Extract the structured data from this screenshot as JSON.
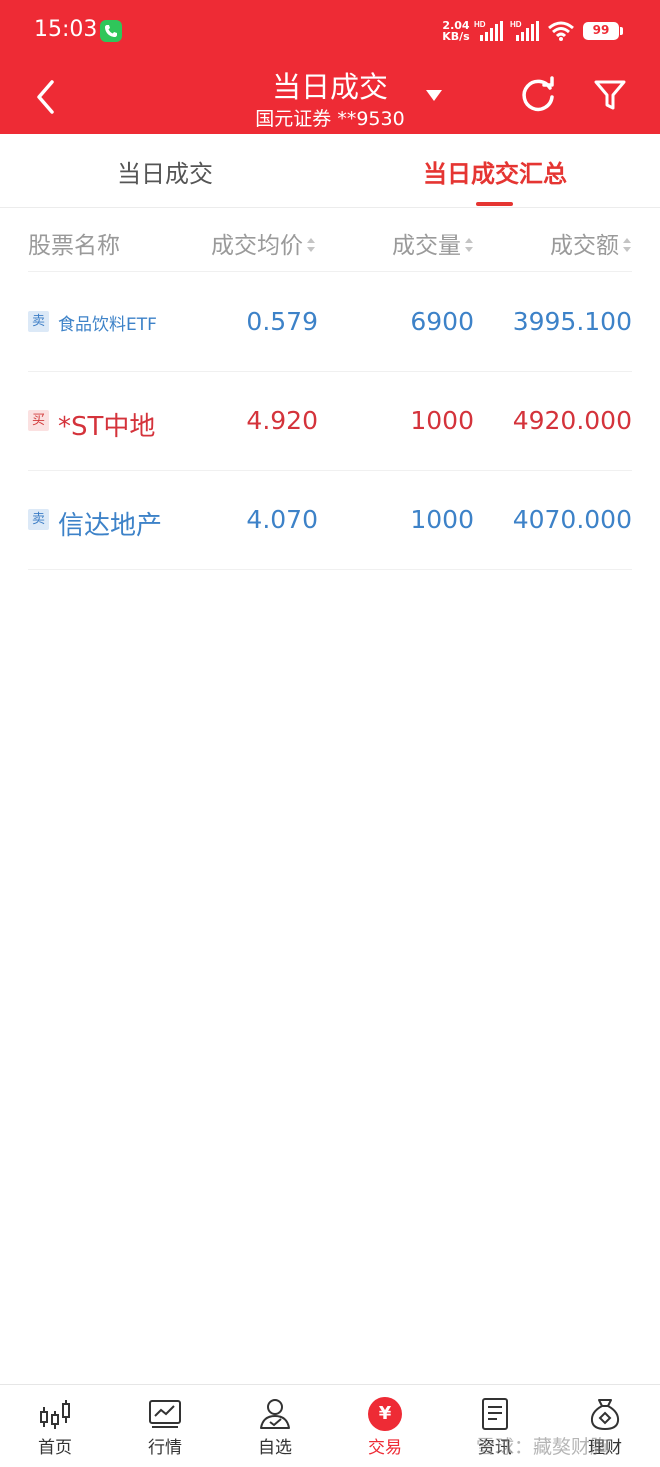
{
  "status_bar": {
    "time": "15:03",
    "net_speed_value": "2.04",
    "net_speed_unit": "KB/s",
    "signal_tag": "HD",
    "battery": "99"
  },
  "nav": {
    "title": "当日成交",
    "subtitle": "国元证券 **9530",
    "icons": [
      "back-icon",
      "dropdown-arrow-icon",
      "refresh-icon",
      "filter-icon"
    ]
  },
  "tabs": [
    {
      "label": "当日成交",
      "active": false
    },
    {
      "label": "当日成交汇总",
      "active": true
    }
  ],
  "table": {
    "columns": [
      "股票名称",
      "成交均价",
      "成交量",
      "成交额"
    ],
    "rows": [
      {
        "side": "卖",
        "name": "食品饮料ETF",
        "avg_price": "0.579",
        "volume": "6900",
        "amount": "3995.100"
      },
      {
        "side": "买",
        "name": "*ST中地",
        "avg_price": "4.920",
        "volume": "1000",
        "amount": "4920.000"
      },
      {
        "side": "卖",
        "name": "信达地产",
        "avg_price": "4.070",
        "volume": "1000",
        "amount": "4070.000"
      }
    ]
  },
  "colors": {
    "brand_red": "#ee2b35",
    "sell_blue": "#3d82c8",
    "buy_red": "#d4333b"
  },
  "bottom_nav": [
    {
      "label": "首页",
      "icon": "candlestick-icon",
      "active": false
    },
    {
      "label": "行情",
      "icon": "chart-icon",
      "active": false
    },
    {
      "label": "自选",
      "icon": "person-check-icon",
      "active": false
    },
    {
      "label": "交易",
      "icon": "yen-icon",
      "icon_text": "¥",
      "active": true
    },
    {
      "label": "资讯",
      "icon": "document-icon",
      "active": false
    },
    {
      "label": "理财",
      "icon": "money-bag-icon",
      "active": false
    }
  ],
  "watermark": "雪球：藏獒财胸"
}
